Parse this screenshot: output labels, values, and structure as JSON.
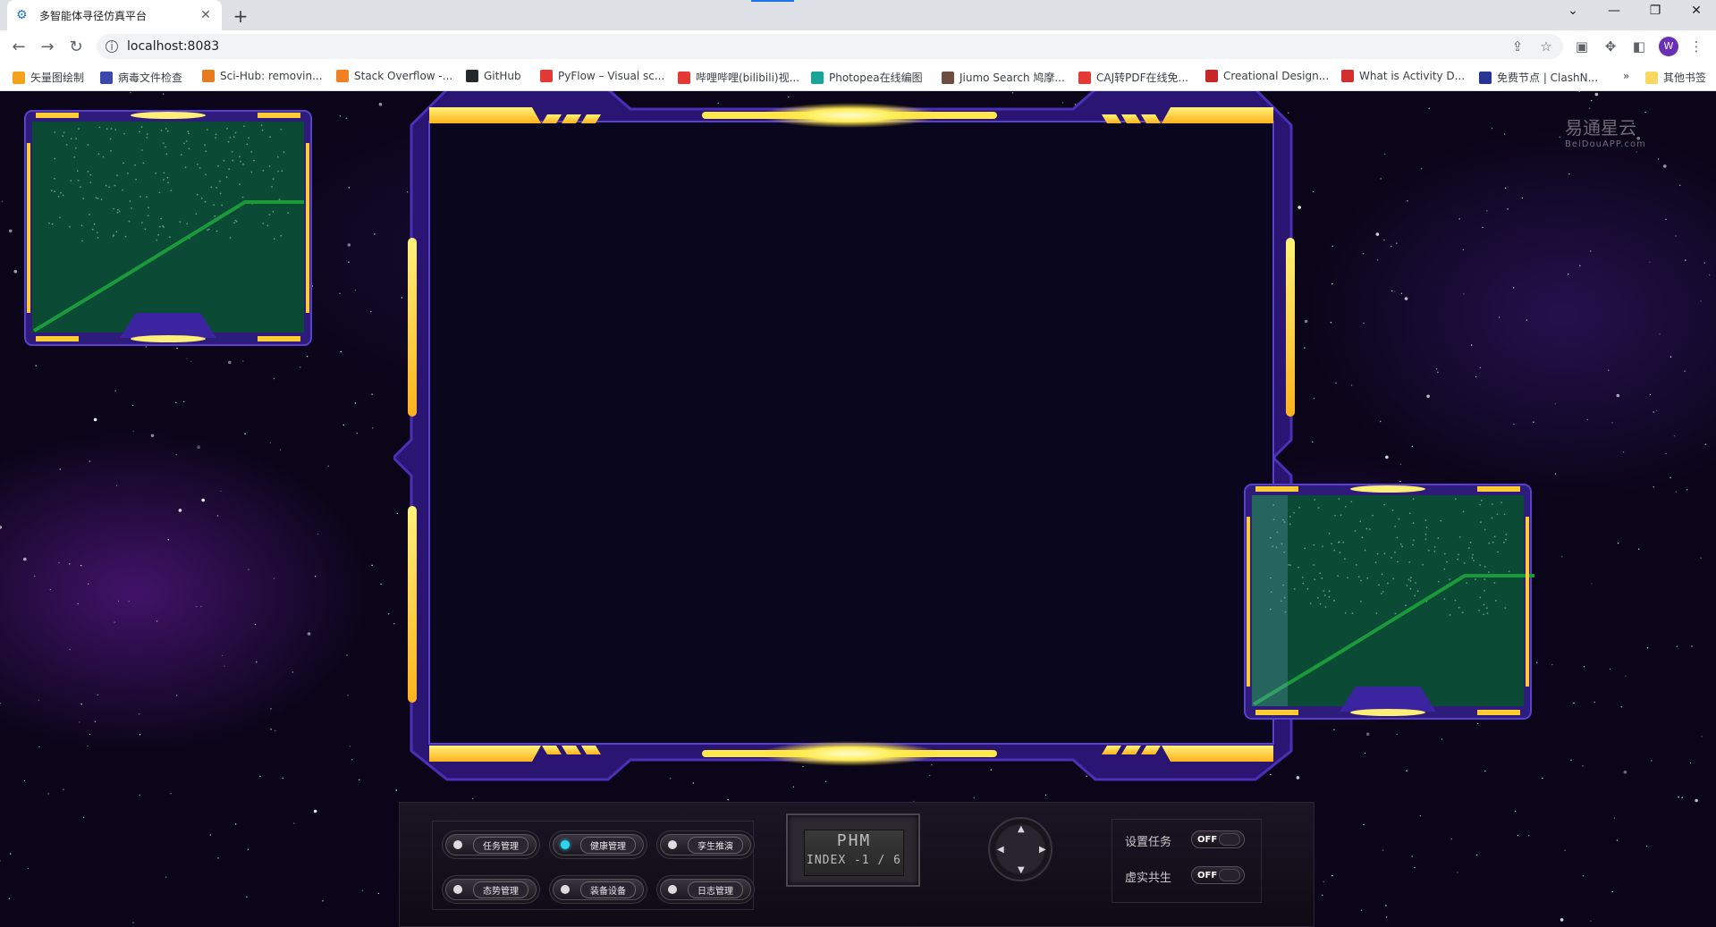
{
  "browser": {
    "tab_title": "多智能体寻径仿真平台",
    "tab_close": "✕",
    "new_tab": "+",
    "url": "localhost:8083",
    "avatar_letter": "W",
    "win_min": "—",
    "win_max": "❐",
    "win_close": "✕",
    "bookmarks": [
      {
        "label": "矢量图绘制",
        "color": "#f4a21c"
      },
      {
        "label": "病毒文件检查",
        "color": "#3949ab"
      },
      {
        "label": "Sci-Hub: removin...",
        "color": "#e57c1f"
      },
      {
        "label": "Stack Overflow -...",
        "color": "#f48024"
      },
      {
        "label": "GitHub",
        "color": "#24292e"
      },
      {
        "label": "PyFlow – Visual sc...",
        "color": "#e53935"
      },
      {
        "label": "哔哩哔哩(bilibili)视...",
        "color": "#e53935"
      },
      {
        "label": "Photopea在线编图",
        "color": "#18a497"
      },
      {
        "label": "Jiumo Search 鸠摩...",
        "color": "#6d4c41"
      },
      {
        "label": "CAJ转PDF在线免...",
        "color": "#e53935"
      },
      {
        "label": "Creational Design...",
        "color": "#c62828"
      },
      {
        "label": "What is Activity D...",
        "color": "#d32f2f"
      },
      {
        "label": "免费节点 | ClashN...",
        "color": "#283593"
      }
    ],
    "more_bookmarks": "»",
    "other_bookmarks": "其他书签"
  },
  "watermark": {
    "title": "易通星云",
    "subtitle": "BeiDouAPP.com"
  },
  "controls": {
    "buttons": [
      {
        "label": "任务管理",
        "active": false
      },
      {
        "label": "健康管理",
        "active": true
      },
      {
        "label": "孪生推演",
        "active": false
      },
      {
        "label": "态势管理",
        "active": false
      },
      {
        "label": "装备设备",
        "active": false
      },
      {
        "label": "日志管理",
        "active": false
      }
    ],
    "lcd": {
      "line1": "PHM",
      "line2": "INDEX -1 / 6"
    },
    "dpad": {
      "up": "▲",
      "down": "▼",
      "left": "◀",
      "right": "▶"
    },
    "settings": [
      {
        "label": "设置任务",
        "state": "OFF"
      },
      {
        "label": "虚实共生",
        "state": "OFF"
      }
    ]
  },
  "colors": {
    "frame_purple": "#3a2090",
    "frame_yellow": "#ffcc33",
    "map_green": "#0b4a34",
    "path_green": "#1a9a3a"
  }
}
